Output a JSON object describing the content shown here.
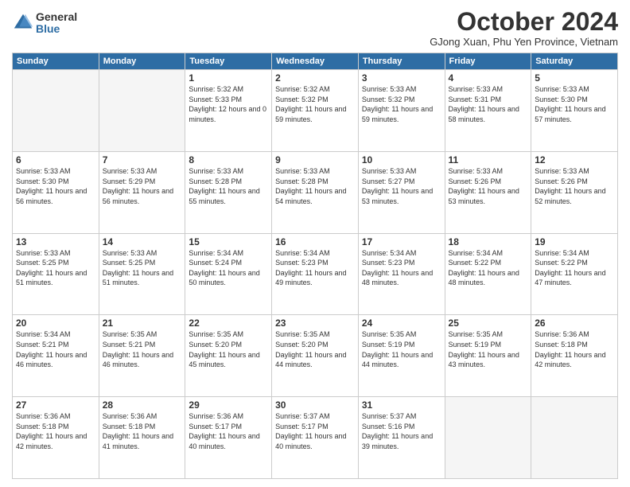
{
  "logo": {
    "general": "General",
    "blue": "Blue"
  },
  "header": {
    "title": "October 2024",
    "subtitle": "GJong Xuan, Phu Yen Province, Vietnam"
  },
  "days_of_week": [
    "Sunday",
    "Monday",
    "Tuesday",
    "Wednesday",
    "Thursday",
    "Friday",
    "Saturday"
  ],
  "weeks": [
    [
      {
        "day": "",
        "info": ""
      },
      {
        "day": "",
        "info": ""
      },
      {
        "day": "1",
        "info": "Sunrise: 5:32 AM\nSunset: 5:33 PM\nDaylight: 12 hours\nand 0 minutes."
      },
      {
        "day": "2",
        "info": "Sunrise: 5:32 AM\nSunset: 5:32 PM\nDaylight: 11 hours\nand 59 minutes."
      },
      {
        "day": "3",
        "info": "Sunrise: 5:33 AM\nSunset: 5:32 PM\nDaylight: 11 hours\nand 59 minutes."
      },
      {
        "day": "4",
        "info": "Sunrise: 5:33 AM\nSunset: 5:31 PM\nDaylight: 11 hours\nand 58 minutes."
      },
      {
        "day": "5",
        "info": "Sunrise: 5:33 AM\nSunset: 5:30 PM\nDaylight: 11 hours\nand 57 minutes."
      }
    ],
    [
      {
        "day": "6",
        "info": "Sunrise: 5:33 AM\nSunset: 5:30 PM\nDaylight: 11 hours\nand 56 minutes."
      },
      {
        "day": "7",
        "info": "Sunrise: 5:33 AM\nSunset: 5:29 PM\nDaylight: 11 hours\nand 56 minutes."
      },
      {
        "day": "8",
        "info": "Sunrise: 5:33 AM\nSunset: 5:28 PM\nDaylight: 11 hours\nand 55 minutes."
      },
      {
        "day": "9",
        "info": "Sunrise: 5:33 AM\nSunset: 5:28 PM\nDaylight: 11 hours\nand 54 minutes."
      },
      {
        "day": "10",
        "info": "Sunrise: 5:33 AM\nSunset: 5:27 PM\nDaylight: 11 hours\nand 53 minutes."
      },
      {
        "day": "11",
        "info": "Sunrise: 5:33 AM\nSunset: 5:26 PM\nDaylight: 11 hours\nand 53 minutes."
      },
      {
        "day": "12",
        "info": "Sunrise: 5:33 AM\nSunset: 5:26 PM\nDaylight: 11 hours\nand 52 minutes."
      }
    ],
    [
      {
        "day": "13",
        "info": "Sunrise: 5:33 AM\nSunset: 5:25 PM\nDaylight: 11 hours\nand 51 minutes."
      },
      {
        "day": "14",
        "info": "Sunrise: 5:33 AM\nSunset: 5:25 PM\nDaylight: 11 hours\nand 51 minutes."
      },
      {
        "day": "15",
        "info": "Sunrise: 5:34 AM\nSunset: 5:24 PM\nDaylight: 11 hours\nand 50 minutes."
      },
      {
        "day": "16",
        "info": "Sunrise: 5:34 AM\nSunset: 5:23 PM\nDaylight: 11 hours\nand 49 minutes."
      },
      {
        "day": "17",
        "info": "Sunrise: 5:34 AM\nSunset: 5:23 PM\nDaylight: 11 hours\nand 48 minutes."
      },
      {
        "day": "18",
        "info": "Sunrise: 5:34 AM\nSunset: 5:22 PM\nDaylight: 11 hours\nand 48 minutes."
      },
      {
        "day": "19",
        "info": "Sunrise: 5:34 AM\nSunset: 5:22 PM\nDaylight: 11 hours\nand 47 minutes."
      }
    ],
    [
      {
        "day": "20",
        "info": "Sunrise: 5:34 AM\nSunset: 5:21 PM\nDaylight: 11 hours\nand 46 minutes."
      },
      {
        "day": "21",
        "info": "Sunrise: 5:35 AM\nSunset: 5:21 PM\nDaylight: 11 hours\nand 46 minutes."
      },
      {
        "day": "22",
        "info": "Sunrise: 5:35 AM\nSunset: 5:20 PM\nDaylight: 11 hours\nand 45 minutes."
      },
      {
        "day": "23",
        "info": "Sunrise: 5:35 AM\nSunset: 5:20 PM\nDaylight: 11 hours\nand 44 minutes."
      },
      {
        "day": "24",
        "info": "Sunrise: 5:35 AM\nSunset: 5:19 PM\nDaylight: 11 hours\nand 44 minutes."
      },
      {
        "day": "25",
        "info": "Sunrise: 5:35 AM\nSunset: 5:19 PM\nDaylight: 11 hours\nand 43 minutes."
      },
      {
        "day": "26",
        "info": "Sunrise: 5:36 AM\nSunset: 5:18 PM\nDaylight: 11 hours\nand 42 minutes."
      }
    ],
    [
      {
        "day": "27",
        "info": "Sunrise: 5:36 AM\nSunset: 5:18 PM\nDaylight: 11 hours\nand 42 minutes."
      },
      {
        "day": "28",
        "info": "Sunrise: 5:36 AM\nSunset: 5:18 PM\nDaylight: 11 hours\nand 41 minutes."
      },
      {
        "day": "29",
        "info": "Sunrise: 5:36 AM\nSunset: 5:17 PM\nDaylight: 11 hours\nand 40 minutes."
      },
      {
        "day": "30",
        "info": "Sunrise: 5:37 AM\nSunset: 5:17 PM\nDaylight: 11 hours\nand 40 minutes."
      },
      {
        "day": "31",
        "info": "Sunrise: 5:37 AM\nSunset: 5:16 PM\nDaylight: 11 hours\nand 39 minutes."
      },
      {
        "day": "",
        "info": ""
      },
      {
        "day": "",
        "info": ""
      }
    ]
  ]
}
